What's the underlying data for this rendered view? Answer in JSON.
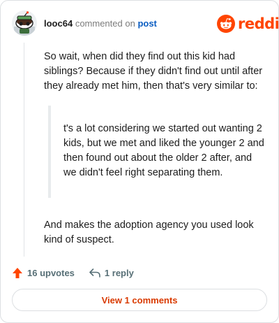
{
  "header": {
    "username": "looc64",
    "action_text": "commented on",
    "post_link": "post",
    "brand": "reddit",
    "avatar_icon": "snoo-avatar-icon",
    "logo_icon": "reddit-alien-icon"
  },
  "comment": {
    "paragraph1": "So wait, when did they find out this kid had siblings? Because if they didn't find out until after they already met him, then that's very similar to:",
    "quote": "t's a lot considering we started out wanting 2 kids, but we met and liked the younger 2 and then found out about the older 2 after, and we didn't feel right separating them.",
    "paragraph2": "And makes the adoption agency you used look kind of suspect."
  },
  "actions": {
    "upvotes": "16 upvotes",
    "reply": "1 reply",
    "upvote_icon": "upvote-arrow-icon",
    "reply_icon": "reply-arrow-icon"
  },
  "footer": {
    "view_comments": "View 1 comments"
  },
  "colors": {
    "brand": "#ff4500",
    "link": "#0a5dc2",
    "view_button_text": "#d93a00",
    "meta_text": "#576f76",
    "border": "#dcdfe2"
  }
}
